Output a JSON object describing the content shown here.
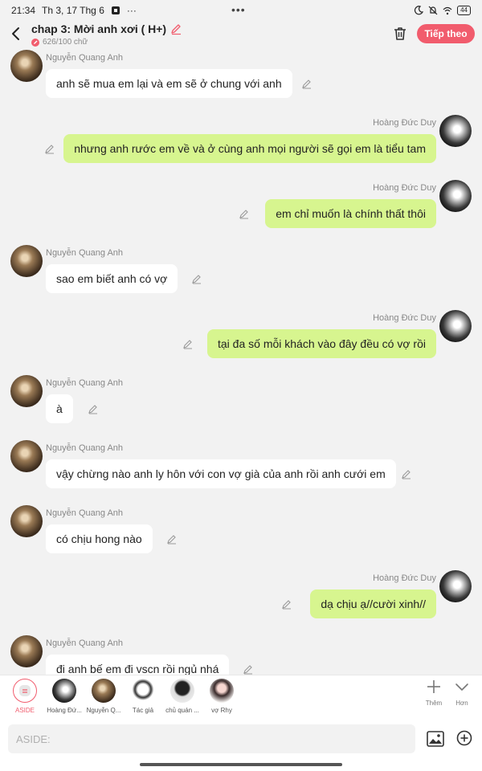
{
  "status_bar": {
    "time": "21:34",
    "date": "Th 3, 17 Thg 6",
    "more": "···",
    "center_dots": "•••",
    "battery": "44"
  },
  "header": {
    "title": "chap 3: Mời anh xơi ( H+)",
    "word_count": "626/100 chữ",
    "continue_label": "Tiếp theo"
  },
  "colors": {
    "accent": "#f15c6d",
    "bubble_right": "#d7f58f",
    "bubble_left": "#ffffff",
    "background": "#f2f2f2"
  },
  "messages": [
    {
      "side": "left",
      "sender": "Nguyễn Quang Anh",
      "text": "anh sẽ mua em lại và em sẽ ở chung với anh"
    },
    {
      "side": "right",
      "sender": "Hoàng Đức Duy",
      "text": "nhưng anh rước em về và ở cùng anh mọi người sẽ gọi em là tiểu tam"
    },
    {
      "side": "right",
      "sender": "Hoàng Đức Duy",
      "text": "em chỉ muốn là chính thất thôi"
    },
    {
      "side": "left",
      "sender": "Nguyễn Quang Anh",
      "text": "sao em biết anh có vợ"
    },
    {
      "side": "right",
      "sender": "Hoàng Đức Duy",
      "text": "tại đa số mỗi khách vào đây đều có vợ rồi"
    },
    {
      "side": "left",
      "sender": "Nguyễn Quang Anh",
      "text": "à"
    },
    {
      "side": "left",
      "sender": "Nguyễn Quang Anh",
      "text": "vậy chừng nào anh ly hôn với con vợ già của anh rồi anh cưới em"
    },
    {
      "side": "left",
      "sender": "Nguyễn Quang Anh",
      "text": "có chịu hong nào"
    },
    {
      "side": "right",
      "sender": "Hoàng Đức Duy",
      "text": "dạ chịu ạ//cười xinh//"
    },
    {
      "side": "left",
      "sender": "Nguyễn Quang Anh",
      "text": "đi anh bế em đi vscn rồi ngủ nhá"
    }
  ],
  "characters": [
    {
      "name": "ASIDE",
      "icon": "aside-icon"
    },
    {
      "name": "Hoàng Đứ...",
      "icon": "avatar-duy"
    },
    {
      "name": "Nguyễn Q...",
      "icon": "avatar-anh"
    },
    {
      "name": "Tác giả",
      "icon": "author-avatar"
    },
    {
      "name": "chủ quán ...",
      "icon": "owner-avatar"
    },
    {
      "name": "vợ Rhy",
      "icon": "rhy-avatar"
    }
  ],
  "tools": {
    "more_label": "Thêm",
    "collapse_label": "Hơn"
  },
  "input": {
    "placeholder": "ASIDE:"
  }
}
